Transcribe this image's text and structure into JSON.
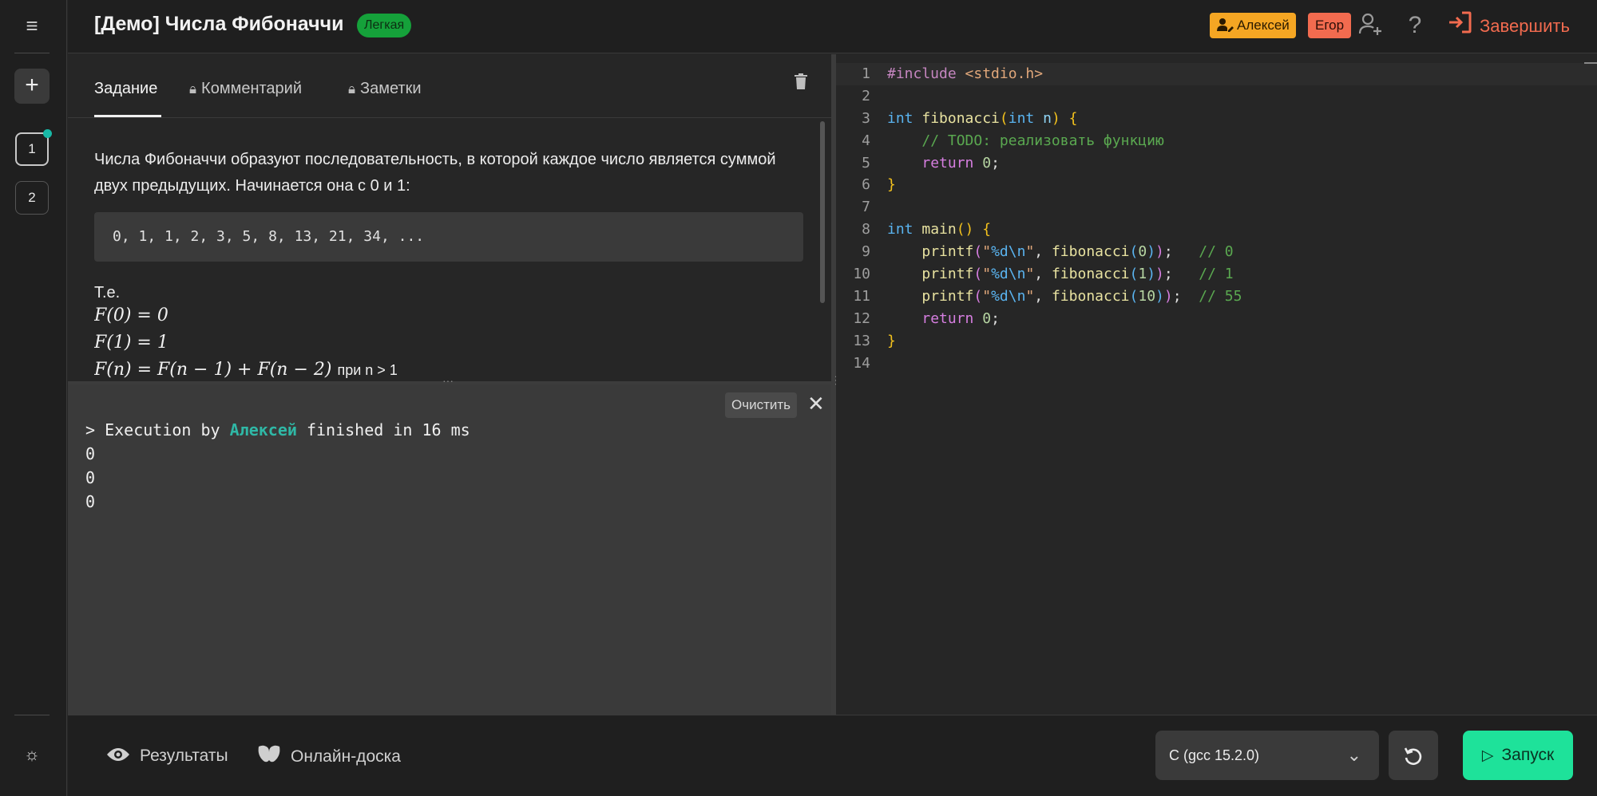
{
  "header": {
    "title": "[Демо] Числа Фибоначчи",
    "difficulty": "Легкая",
    "participants": [
      "Алексей",
      "Егор"
    ],
    "finish_label": "Завершить"
  },
  "sidebar": {
    "tasks": [
      {
        "label": "1",
        "active": true,
        "has_dot": true
      },
      {
        "label": "2",
        "active": false,
        "has_dot": false
      }
    ]
  },
  "tabs": [
    {
      "label": "Задание",
      "active": true,
      "locked": false
    },
    {
      "label": "Комментарий",
      "active": false,
      "locked": true
    },
    {
      "label": "Заметки",
      "active": false,
      "locked": true
    }
  ],
  "description": {
    "paragraph": "Числа Фибоначчи образуют последовательность, в которой каждое число является суммой двух предыдущих. Начинается она с 0 и 1:",
    "sequence": "0, 1, 1, 2, 3, 5, 8, 13, 21, 34, ...",
    "te": "Т.е.",
    "f0": "F(0) = 0",
    "f1": "F(1) = 1",
    "fn": "F(n) = F(n − 1) + F(n − 2)",
    "fn_cond": "при n > 1"
  },
  "console": {
    "clear_label": "Очистить",
    "exec_prefix": "> Execution by ",
    "exec_user": "Алексей",
    "exec_suffix": " finished in 16 ms",
    "output": [
      "0",
      "0",
      "0"
    ]
  },
  "editor": {
    "line_numbers": [
      "1",
      "2",
      "3",
      "4",
      "5",
      "6",
      "7",
      "8",
      "9",
      "10",
      "11",
      "12",
      "13",
      "14"
    ]
  },
  "footer": {
    "results_label": "Результаты",
    "board_label": "Онлайн-доска",
    "language": "C (gcc 15.2.0)",
    "run_label": "Запуск"
  },
  "colors": {
    "accent_run": "#1ee29a",
    "finish": "#f26b4f",
    "user_a": "#f5a623",
    "user_e": "#f26b4f",
    "difficulty": "#15a13a"
  }
}
